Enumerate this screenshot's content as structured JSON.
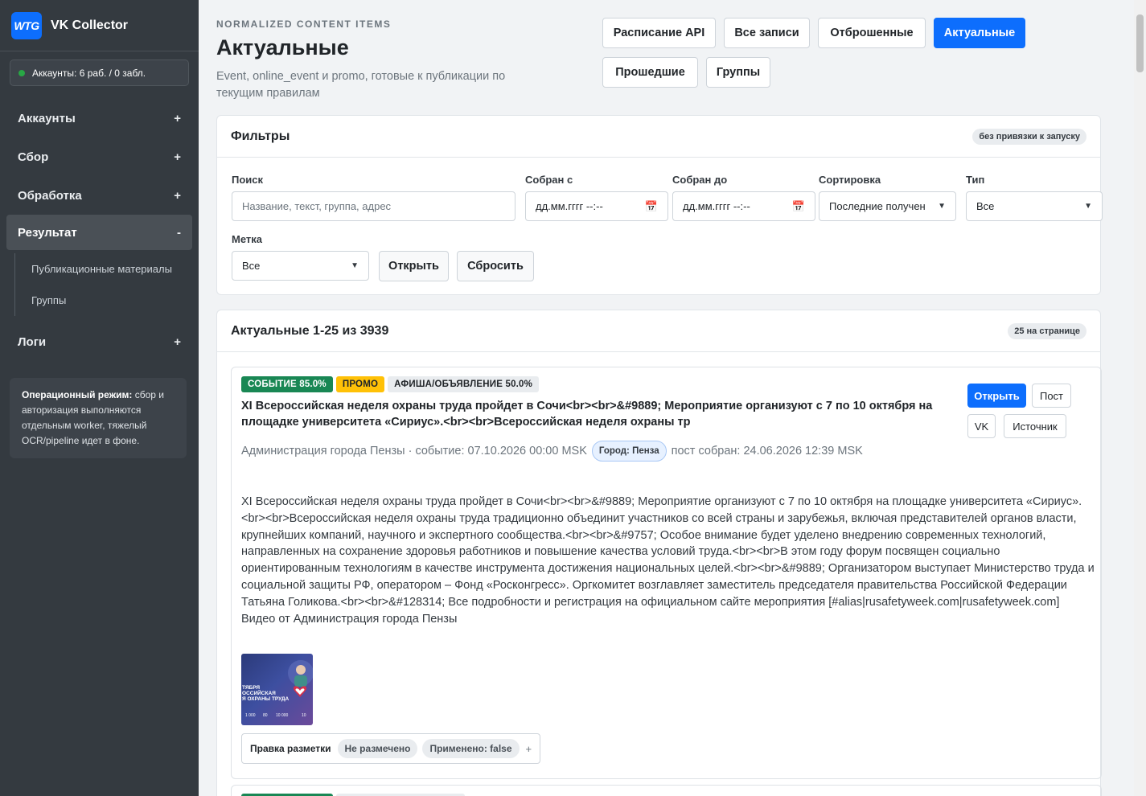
{
  "brand": {
    "logo_text": "WTG",
    "name": "VK Collector"
  },
  "accounts_status": "Аккаунты: 6 раб. / 0 забл.",
  "nav": {
    "accounts": "Аккаунты",
    "collect": "Сбор",
    "processing": "Обработка",
    "result": "Результат",
    "result_sub": [
      "Публикационные материалы",
      "Группы"
    ],
    "logs": "Логи",
    "toggle_plus": "+",
    "toggle_minus": "-"
  },
  "op_note": {
    "bold": "Операционный режим:",
    "text": " сбор и авторизация выполняются отдельным worker, тяжелый OCR/pipeline идет в фоне."
  },
  "header": {
    "eyebrow": "NORMALIZED CONTENT ITEMS",
    "title": "Актуальные",
    "subtitle": "Event, online_event и promo, готовые к публикации по текущим правилам"
  },
  "top_buttons": {
    "api_schedule": "Расписание API",
    "all_records": "Все записи",
    "rejected": "Отброшенные",
    "actual": "Актуальные",
    "past": "Прошедшие",
    "groups": "Группы"
  },
  "filters": {
    "title": "Фильтры",
    "badge": "без привязки к запуску",
    "search_label": "Поиск",
    "search_placeholder": "Название, текст, группа, адрес",
    "from_label": "Собран с",
    "from_placeholder": "дд.мм.гггг --:--",
    "to_label": "Собран до",
    "to_placeholder": "дд.мм.гггг --:--",
    "sort_label": "Сортировка",
    "sort_value": "Последние получен",
    "type_label": "Тип",
    "type_value": "Все",
    "tag_label": "Метка",
    "tag_value": "Все",
    "open": "Открыть",
    "reset": "Сбросить"
  },
  "results": {
    "title": "Актуальные 1-25 из 3939",
    "per_page": "25 на странице"
  },
  "item": {
    "badges": [
      {
        "label": "СОБЫТИЕ 85.0%",
        "bg": "#198754",
        "fg": "#ffffff"
      },
      {
        "label": "ПРОМО",
        "bg": "#ffc107",
        "fg": "#212529"
      },
      {
        "label": "АФИША/ОБЪЯВЛЕНИЕ 50.0%",
        "bg": "#e9ecef",
        "fg": "#212529"
      }
    ],
    "title": "XI Всероссийская неделя охраны труда пройдет в Сочи<br><br>&#9889; Мероприятие организуют с 7 по 10 октября на площадке университета «Сириус».<br><br>Всероссийская неделя охраны тр",
    "meta_left": "Администрация города Пензы · событие: 07.10.2026 00:00 MSK",
    "city": "Город: Пенза",
    "meta_right": "пост собран: 24.06.2026 12:39 MSK",
    "text": "XI Всероссийская неделя охраны труда пройдет в Сочи<br><br>&#9889; Мероприятие организуют с 7 по 10 октября на площадке университета «Сириус».<br><br>Всероссийская неделя охраны труда традиционно объединит участников со всей страны и зарубежья, включая представителей органов власти, крупнейших компаний, научного и экспертного сообщества.<br><br>&#9757; Особое внимание будет уделено внедрению современных технологий, направленных на сохранение здоровья работников и повышение качества условий труда.<br><br>В этом году форум посвящен социально ориентированным технологиям в качестве инструмента достижения национальных целей.<br><br>&#9889; Организатором выступает Министерство труда и социальной защиты РФ, оператором – Фонд «Росконгресс». Оргкомитет возглавляет заместитель председателя правительства Российской Федерации Татьяна Голикова.<br><br>&#128314; Все подробности и регистрация на официальном сайте мероприятия [#alias|rusafetyweek.com|rusafetyweek.com] Видео от Администрация города Пензы",
    "buttons": {
      "open": "Открыть",
      "post": "Пост",
      "vk": "VK",
      "source": "Источник"
    },
    "thumb_text": [
      "ТЯБРЯ",
      "ОССИЙСКАЯ",
      "Я ОХРАНЫ ТРУДА"
    ],
    "thumb_numbers": [
      "1 000",
      "80",
      "10 000",
      "10"
    ],
    "markup": {
      "label": "Правка разметки",
      "state": "Не размечено",
      "applied": "Применено: false",
      "plus": "+"
    }
  },
  "colors": {
    "primary": "#0d6efd",
    "sidebar": "#343a40",
    "success": "#198754",
    "warning": "#ffc107"
  }
}
